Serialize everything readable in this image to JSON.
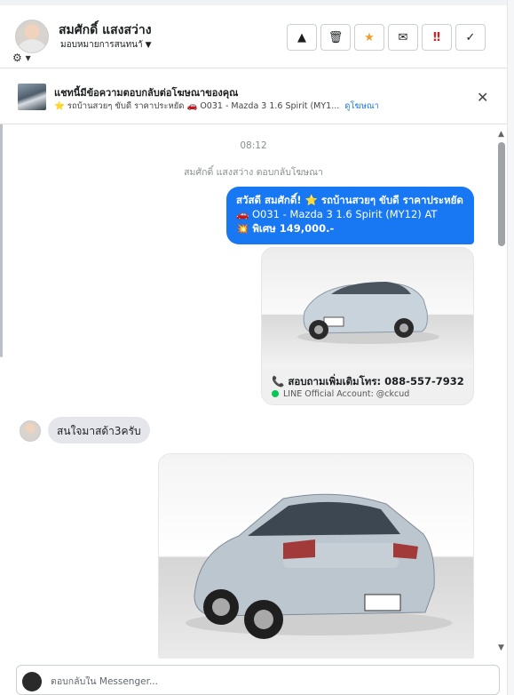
{
  "header": {
    "contact_name": "สมศักดิ์ แสงสว่าง",
    "assign_label": "มอบหมายการสนทนาั",
    "assign_chevron": "▼",
    "settings_glyph": "⚙ ▾",
    "actions": [
      {
        "icon": "warning-icon",
        "glyph": "▲"
      },
      {
        "icon": "trash-icon",
        "glyph": "🗑"
      },
      {
        "icon": "star-icon",
        "glyph": "★"
      },
      {
        "icon": "envelope-icon",
        "glyph": "✉"
      },
      {
        "icon": "urgent-icon",
        "glyph": "‼"
      },
      {
        "icon": "check-icon",
        "glyph": "✓"
      }
    ]
  },
  "ad_banner": {
    "title": "แชทนี้มีข้อความตอบกลับต่อโฆษณาของคุณ",
    "subtitle": "⭐ รถบ้านสวยๆ ขับดี ราคาประหยัด 🚗 O031 - Mazda 3 1.6 Spirit (MY1...",
    "link": "ดูโฆษณา",
    "close": "✕"
  },
  "chat": {
    "time": "08:12",
    "event": "สมศักดิ์ แสงสว่าง ตอบกลับโฆษณา",
    "outgoing": {
      "line1": "สวัสดี สมศักดิ์! ⭐ รถบ้านสวยๆ ขับดี ราคาประหยัด",
      "line2": "🚗 O031 - Mazda 3 1.6 Spirit (MY12) AT",
      "line3": "💥 พิเศษ 149,000.-"
    },
    "card": {
      "call_label": "สอบถามเพิ่มเติมโทร: 088-557-7932",
      "call_icon": "📞",
      "line_account": "LINE Official Account: @ckcud"
    },
    "incoming": {
      "text": "สนใจมาสด้า3ครับ"
    }
  },
  "scroll": {
    "up": "▲",
    "down": "▼"
  },
  "composer": {
    "placeholder": "ตอบกลับใน Messenger..."
  },
  "colors": {
    "accent": "#1877f2",
    "incoming_bubble": "#e4e6eb",
    "line_green": "#06c755"
  }
}
